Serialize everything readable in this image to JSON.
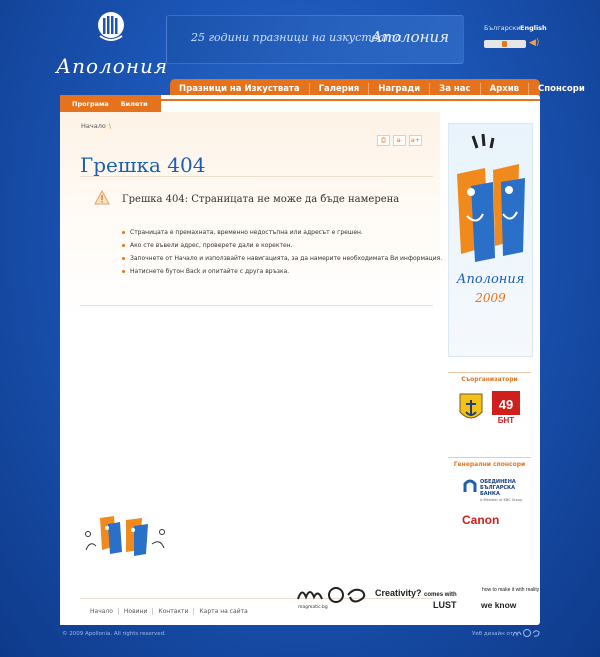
{
  "header": {
    "logo_word": "Аполония",
    "banner_tagline": "25 години празници на изкуствата",
    "banner_word": "Аполония",
    "languages": [
      "Български",
      "English"
    ]
  },
  "main_nav": [
    "Празници на Изкуствата",
    "Галерия",
    "Награди",
    "За нас",
    "Архив",
    "Спонсори"
  ],
  "sub_nav": [
    "Програма",
    "Билети"
  ],
  "breadcrumb": [
    "Начало"
  ],
  "page_tools": [
    "⎙",
    "a-",
    "a+"
  ],
  "page": {
    "title": "Грешка 404",
    "error_message": "Грешка 404: Страницата не може да бъде намерена",
    "bullets": [
      "Страницата е премахната, временно недостъпна или адресът е грешен.",
      "Ако сте въвели адрес, проверете дали е коректен.",
      "Започнете от Начало и използвайте навигацията, за да намерите необходимата Ви информация.",
      "Натиснете бутон Back и опитайте с друга връзка."
    ]
  },
  "sidebar": {
    "poster_word": "Аполония",
    "poster_year": "2009",
    "co_organizers_heading": "Съорганизатори",
    "co_organizers": [
      "Созопол",
      "БНТ"
    ],
    "sponsors_heading": "Генерални спонсори",
    "ubb_name": "ОБЕДИНЕНА БЪЛГАРСКА БАНКА",
    "ubb_sub": "A Member of KBC Group",
    "canon": "Canon"
  },
  "partners": {
    "mpg_sub": "magmatic.bg",
    "creativity": "Creativity?",
    "comes_with": "comes with",
    "lust": "LUST",
    "knowhow": "how to make it with reality",
    "weknow": "we know"
  },
  "footer": {
    "links": [
      "Начало",
      "Новини",
      "Контакти",
      "Карта на сайта"
    ],
    "copyright": "© 2009 Apollonia. All rights reserved.",
    "credit": "Уеб дизайн от"
  },
  "colors": {
    "accent": "#e5731d",
    "brand_blue": "#1b5fb5",
    "page_bg": "#1b55b5"
  }
}
